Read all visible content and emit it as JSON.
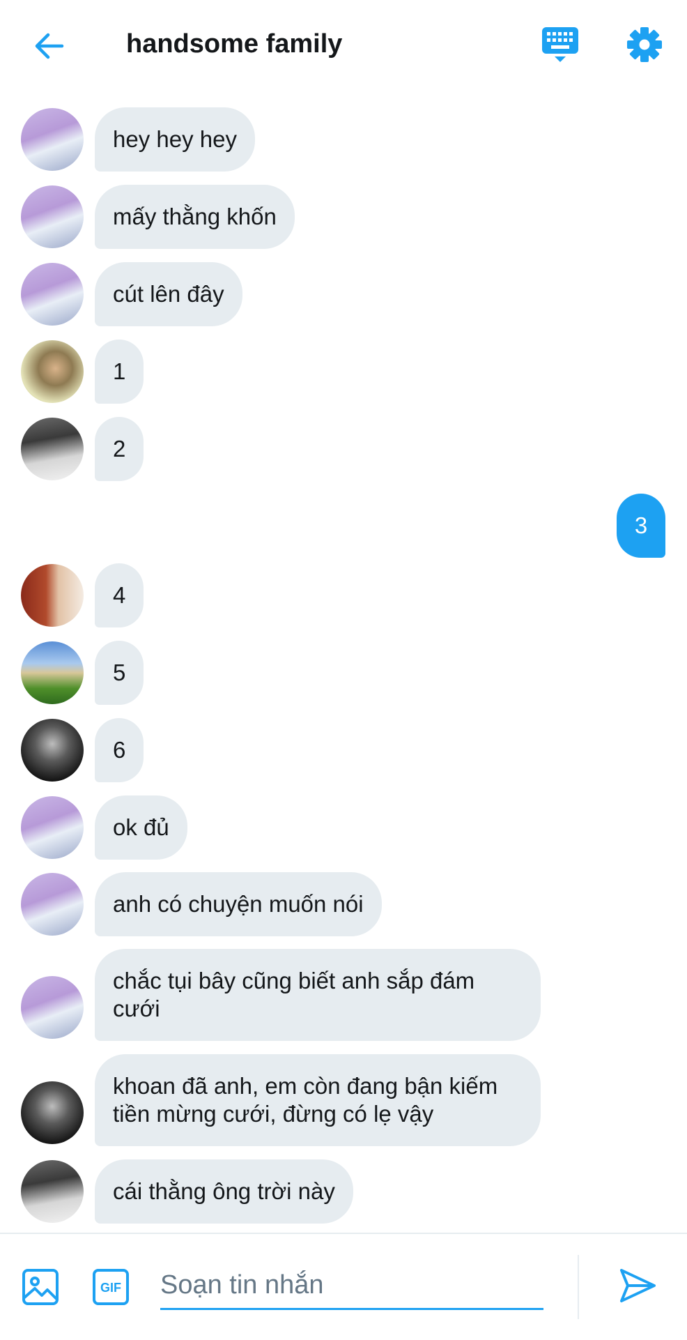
{
  "header": {
    "title": "handsome family",
    "back_icon": "arrow-left-icon",
    "keyboard_icon": "keyboard-icon",
    "settings_icon": "gear-icon"
  },
  "messages": [
    {
      "text": "hey hey hey",
      "sender": "jin"
    },
    {
      "text": "mấy thằng khốn",
      "sender": "jin"
    },
    {
      "text": "cút lên đây",
      "sender": "jin"
    },
    {
      "text": "1",
      "sender": "suga"
    },
    {
      "text": "2",
      "sender": "rm"
    },
    {
      "text": "3",
      "sender": "me"
    },
    {
      "text": "4",
      "sender": "jhope"
    },
    {
      "text": "5",
      "sender": "v"
    },
    {
      "text": "6",
      "sender": "jungkook"
    },
    {
      "text": "ok đủ",
      "sender": "jin"
    },
    {
      "text": "anh có chuyện muốn nói",
      "sender": "jin"
    },
    {
      "text": "chắc tụi bây cũng biết anh sắp đám cưới",
      "sender": "jin"
    },
    {
      "text": "khoan đã anh, em còn đang bận kiếm tiền mừng cưới, đừng có lẹ vậy",
      "sender": "jungkook"
    },
    {
      "text": "cái thằng ông trời này",
      "sender": "rm"
    }
  ],
  "composer": {
    "placeholder": "Soạn tin nhắn",
    "image_icon": "image-icon",
    "gif_icon": "gif-icon",
    "gif_label": "GIF",
    "send_icon": "send-icon"
  },
  "colors": {
    "accent": "#1da1f2",
    "received_bubble": "#e6ecf0",
    "text": "#14171a",
    "placeholder": "#657786"
  }
}
